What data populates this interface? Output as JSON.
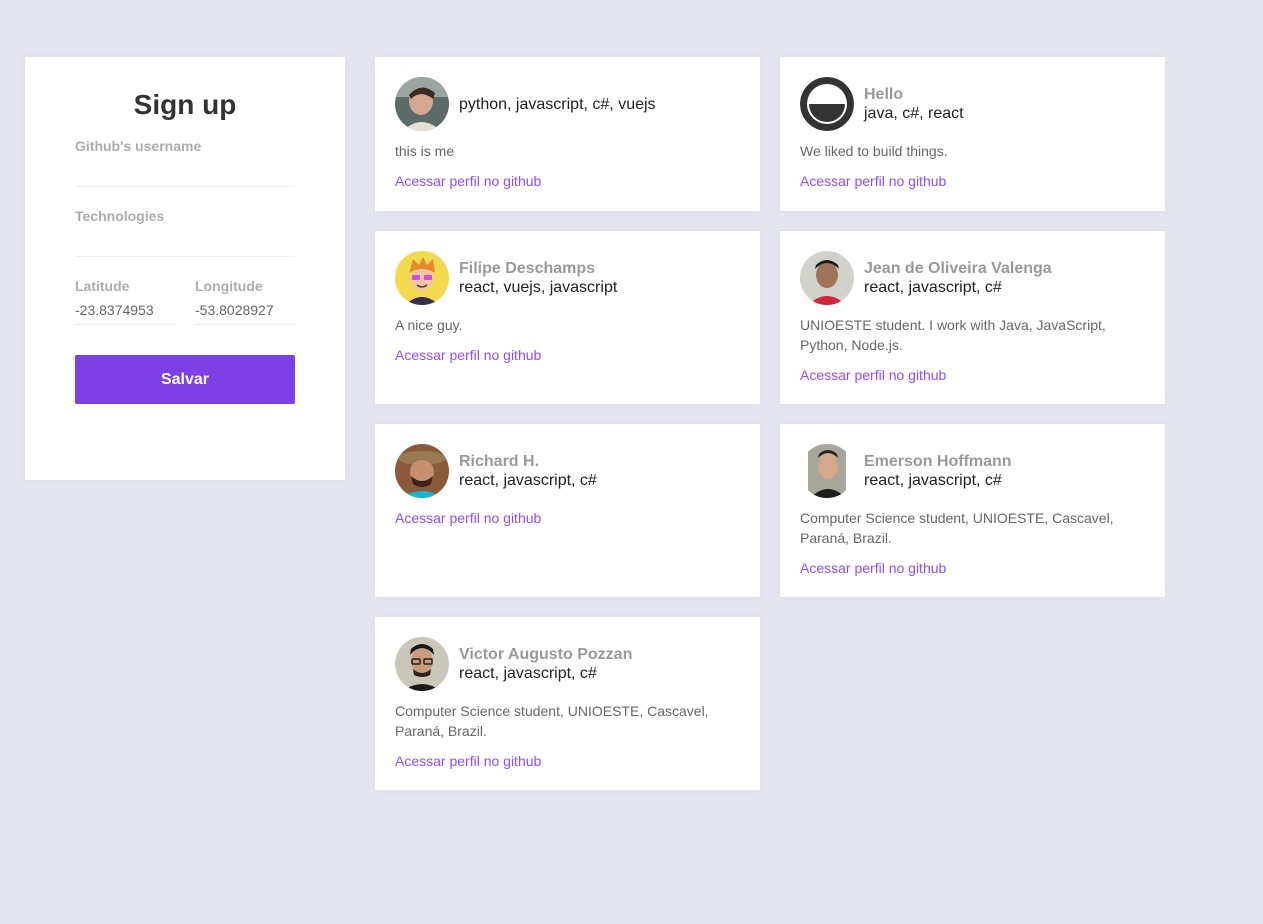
{
  "signup": {
    "title": "Sign up",
    "github_username_label": "Github's username",
    "github_username_value": "",
    "techs_label": "Technologies",
    "techs_value": "",
    "latitude_label": "Latitude",
    "latitude_value": "-23.8374953",
    "longitude_label": "Longitude",
    "longitude_value": "-53.8028927",
    "save_label": "Salvar"
  },
  "colors": {
    "accent": "#7d40e7",
    "link": "#8e4dff",
    "background": "#e5e5ef"
  },
  "devs": [
    {
      "name": "",
      "techs": "python, javascript, c#, vuejs",
      "bio": "this is me",
      "link": "Acessar perfil no github",
      "avatar_icon": "profile-photo"
    },
    {
      "name": "Hello",
      "techs": "java, c#, react",
      "bio": "We liked to build things.",
      "link": "Acessar perfil no github",
      "avatar_icon": "circle-logo"
    },
    {
      "name": "Filipe Deschamps",
      "techs": "react, vuejs, javascript",
      "bio": "A nice guy.",
      "link": "Acessar perfil no github",
      "avatar_icon": "cartoon-avatar"
    },
    {
      "name": "Jean de Oliveira Valenga",
      "techs": "react, javascript, c#",
      "bio": "UNIOESTE student. I work with Java, JavaScript, Python, Node.js.",
      "link": "Acessar perfil no github",
      "avatar_icon": "profile-photo"
    },
    {
      "name": "Richard H.",
      "techs": "react, javascript, c#",
      "bio": "",
      "link": "Acessar perfil no github",
      "avatar_icon": "profile-photo"
    },
    {
      "name": "Emerson Hoffmann",
      "techs": "react, javascript, c#",
      "bio": "Computer Science student, UNIOESTE, Cascavel, Paraná, Brazil.",
      "link": "Acessar perfil no github",
      "avatar_icon": "profile-photo"
    },
    {
      "name": "Victor Augusto Pozzan",
      "techs": "react, javascript, c#",
      "bio": "Computer Science student, UNIOESTE, Cascavel, Paraná, Brazil.",
      "link": "Acessar perfil no github",
      "avatar_icon": "profile-photo"
    }
  ]
}
